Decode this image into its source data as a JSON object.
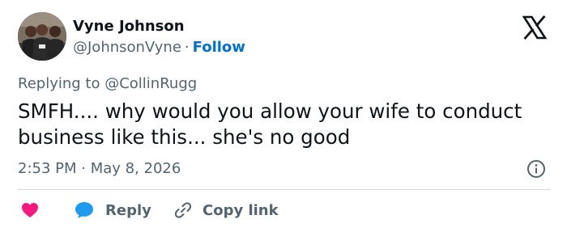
{
  "author": {
    "name": "Vyne Johnson",
    "handle": "@JohnsonVyne",
    "separator": "·",
    "follow_label": "Follow"
  },
  "reply_context": {
    "prefix": "Replying to",
    "mention": "@CollinRugg"
  },
  "tweet": {
    "text": "SMFH.... why would you allow your wife to conduct business like this... she's no good",
    "timestamp": "2:53 PM · May 8, 2026"
  },
  "actions": {
    "reply_label": "Reply",
    "copy_label": "Copy link"
  },
  "icons": {
    "platform": "x-logo-icon",
    "info": "info-icon",
    "like": "heart-icon",
    "reply": "speech-bubble-icon",
    "copy": "link-icon"
  },
  "colors": {
    "follow": "#006fd6",
    "heart": "#f91880",
    "reply_bubble": "#1d9bf0",
    "secondary_text": "#536471"
  }
}
